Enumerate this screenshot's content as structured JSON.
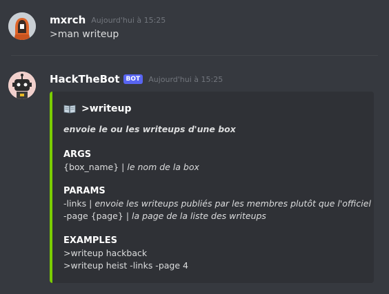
{
  "messages": [
    {
      "author": "mxrch",
      "timestamp": "Aujourd'hui à 15:25",
      "text": ">man writeup"
    },
    {
      "author": "HackTheBot",
      "badge": "BOT",
      "timestamp": "Aujourd'hui à 15:25",
      "embed": {
        "accent_color": "#7acc00",
        "icon": "open-book-icon",
        "title": ">writeup",
        "description": "envoie le ou les writeups d'une box",
        "fields": {
          "args": {
            "name": "ARGS",
            "line1_cmd": "{box_name}",
            "line1_sep": " | ",
            "line1_desc": "le nom de la box"
          },
          "params": {
            "name": "PARAMS",
            "line1_cmd": "-links",
            "line1_sep": " | ",
            "line1_desc": "envoie les writeups publiés par les membres plutôt que l'officiel",
            "line2_cmd": "-page {page}",
            "line2_sep": " | ",
            "line2_desc": "la page de la liste des writeups"
          },
          "examples": {
            "name": "EXAMPLES",
            "line1": ">writeup hackback",
            "line2": ">writeup heist -links -page 4"
          }
        }
      }
    }
  ]
}
